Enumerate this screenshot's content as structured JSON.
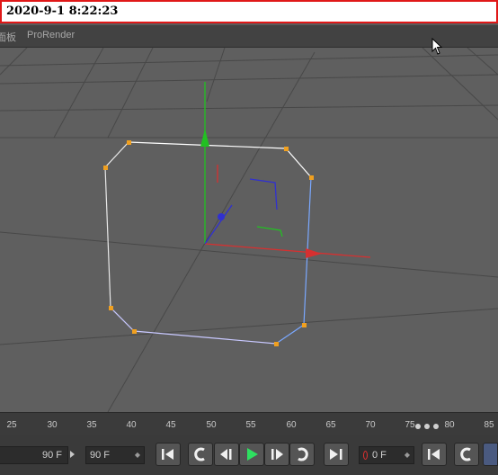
{
  "timestamp": "2020-9-1 8:22:23",
  "menu": {
    "items": [
      {
        "label": "面板"
      },
      {
        "label": "ProRender"
      }
    ]
  },
  "timeline": {
    "tick_labels": [
      "25",
      "30",
      "35",
      "40",
      "45",
      "50",
      "55",
      "60",
      "65",
      "70",
      "75",
      "80",
      "85"
    ]
  },
  "toolbar": {
    "current_frame": "90 F",
    "end_frame": "90 F",
    "key_field": "0 F"
  },
  "colors": {
    "x_axis": "#d63030",
    "y_axis": "#22c022",
    "z_axis": "#3030d0",
    "spline": "#ffffff",
    "point": "#f0a020",
    "banner_border": "#e01818"
  },
  "icons": [
    "go-to-start-icon",
    "previous-key-icon",
    "previous-frame-icon",
    "play-icon",
    "next-frame-icon",
    "next-key-icon",
    "go-to-end-icon",
    "record-key-icon"
  ]
}
